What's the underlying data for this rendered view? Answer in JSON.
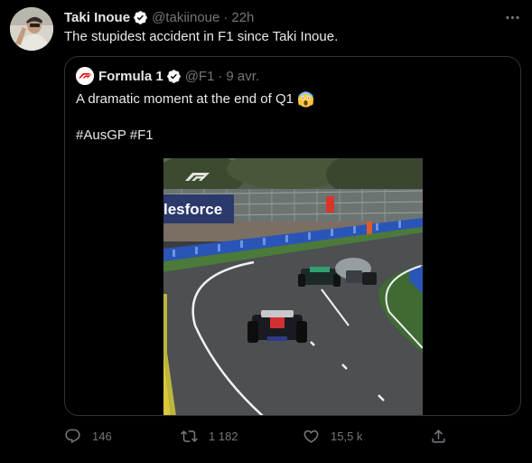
{
  "tweet": {
    "author_name": "Taki Inoue",
    "handle": "@takiinoue",
    "separator": "·",
    "time": "22h",
    "text": "The stupidest accident in F1 since Taki Inoue."
  },
  "quoted": {
    "author_name": "Formula 1",
    "handle": "@F1",
    "separator": "·",
    "date": "9 avr.",
    "text_line1": "A dramatic moment at the end of Q1",
    "text_line2": "#AusGP #F1",
    "emoji": "face-screaming-in-fear",
    "media": {
      "banner_text": "lesforce",
      "watermark": "F1"
    }
  },
  "actions": {
    "replies": "146",
    "retweets": "1 182",
    "likes": "15,5 k"
  },
  "colors": {
    "background": "#000000",
    "text": "#e7e9ea",
    "secondary": "#71767b",
    "border": "#2f3336",
    "verified": "#ffffff",
    "f1_red": "#e10600"
  }
}
